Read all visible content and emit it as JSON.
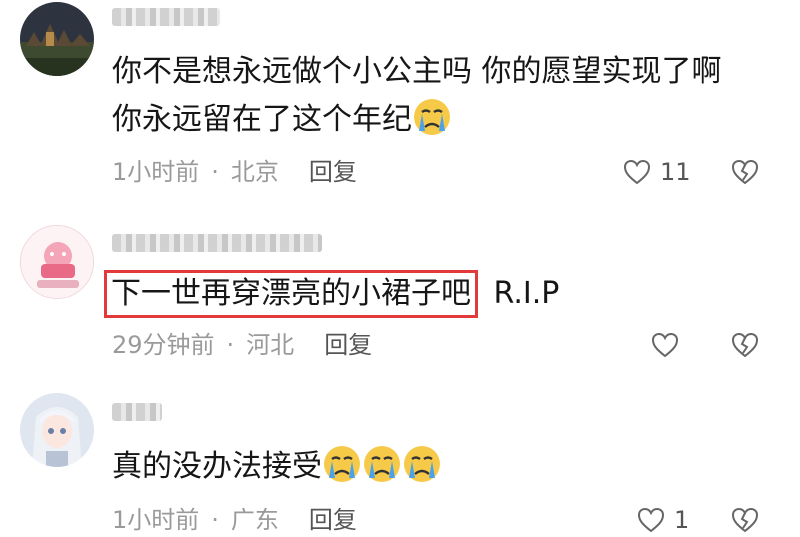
{
  "comments": [
    {
      "lines": [
        "你不是想永远做个小公主吗 你的愿望实现了啊",
        "你永远留在了这个年纪"
      ],
      "emoji_count": 1,
      "time": "1小时前",
      "location": "北京",
      "reply_label": "回复",
      "likes": "11",
      "avatar_icon": "night-castle-avatar"
    },
    {
      "highlighted_text": "下一世再穿漂亮的小裙子吧",
      "trailing_text": "R.I.P",
      "time": "29分钟前",
      "location": "河北",
      "reply_label": "回复",
      "likes": "",
      "avatar_icon": "cartoon-cake-avatar"
    },
    {
      "lines": [
        "真的没办法接受"
      ],
      "emoji_count": 3,
      "time": "1小时前",
      "location": "广东",
      "reply_label": "回复",
      "likes": "1",
      "avatar_icon": "anime-girl-avatar"
    }
  ],
  "separator": "·",
  "colors": {
    "highlight_border": "#e23a3a",
    "meta_text": "#9a9a9a",
    "emoji_face": "#f7c948",
    "emoji_tear": "#4aa3e8"
  }
}
